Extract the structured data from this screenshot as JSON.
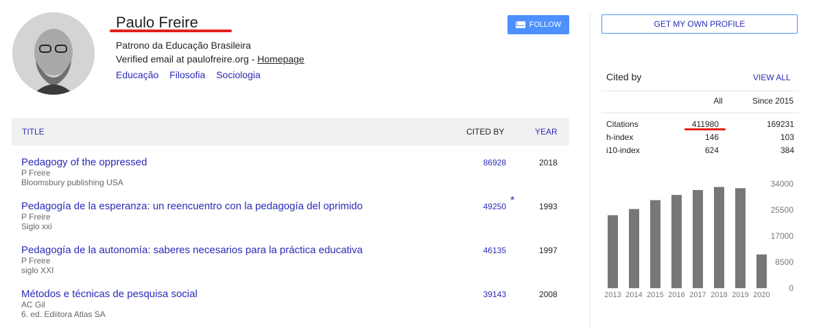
{
  "profile": {
    "name": "Paulo Freire",
    "affiliation": "Patrono da Educação Brasileira",
    "email_prefix": "Verified email at paulofreire.org - ",
    "homepage": "Homepage",
    "interests": [
      "Educação",
      "Filosofia",
      "Sociologia"
    ],
    "follow_label": "FOLLOW",
    "follow_icon": "mail-icon"
  },
  "table": {
    "headers": {
      "title": "TITLE",
      "cited_by": "CITED BY",
      "year": "YEAR"
    },
    "rows": [
      {
        "title": "Pedagogy of the oppressed",
        "authors": "P Freire",
        "venue": "Bloomsbury publishing USA",
        "cites": "86928",
        "star": "",
        "year": "2018"
      },
      {
        "title": "Pedagogía de la esperanza: un reencuentro con la pedagogía del oprimido",
        "authors": "P Freire",
        "venue": "Siglo xxi",
        "cites": "49250",
        "star": "*",
        "year": "1993"
      },
      {
        "title": "Pedagogía de la autonomía: saberes necesarios para la práctica educativa",
        "authors": "P Freire",
        "venue": "siglo XXI",
        "cites": "46135",
        "star": "",
        "year": "1997"
      },
      {
        "title": "Métodos e técnicas de pesquisa social",
        "authors": "AC Gil",
        "venue": "6. ed. Ediitora Atlas SA",
        "cites": "39143",
        "star": "",
        "year": "2008"
      }
    ]
  },
  "sidebar": {
    "get_profile": "GET MY OWN PROFILE",
    "cited_by": "Cited by",
    "view_all": "VIEW ALL",
    "col_all": "All",
    "col_since": "Since 2015",
    "stats": [
      {
        "label": "Citations",
        "all": "411980",
        "since": "169231"
      },
      {
        "label": "h-index",
        "all": "146",
        "since": "103"
      },
      {
        "label": "i10-index",
        "all": "624",
        "since": "384"
      }
    ]
  },
  "chart_data": {
    "type": "bar",
    "categories": [
      "2013",
      "2014",
      "2015",
      "2016",
      "2017",
      "2018",
      "2019",
      "2020"
    ],
    "values": [
      23800,
      25800,
      28700,
      30400,
      32000,
      33000,
      32600,
      11000
    ],
    "ylim": [
      0,
      34000
    ],
    "yticks": [
      "34000",
      "25500",
      "17000",
      "8500",
      "0"
    ],
    "bar_color": "#777777"
  },
  "colors": {
    "accent": "#4d90fe",
    "link": "#2a2ab8",
    "highlight": "#e0201c"
  }
}
